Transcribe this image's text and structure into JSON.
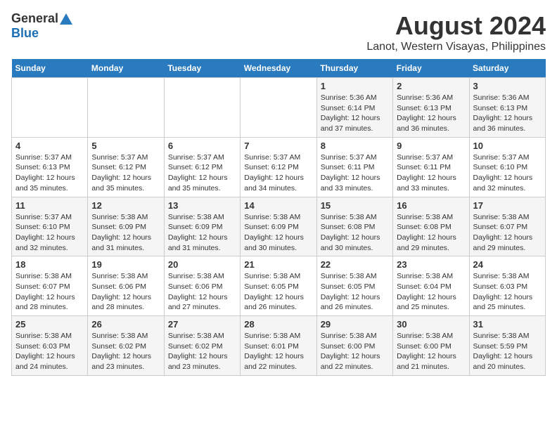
{
  "header": {
    "logo_general": "General",
    "logo_blue": "Blue",
    "month_title": "August 2024",
    "location": "Lanot, Western Visayas, Philippines"
  },
  "weekdays": [
    "Sunday",
    "Monday",
    "Tuesday",
    "Wednesday",
    "Thursday",
    "Friday",
    "Saturday"
  ],
  "weeks": [
    [
      {
        "day": "",
        "detail": ""
      },
      {
        "day": "",
        "detail": ""
      },
      {
        "day": "",
        "detail": ""
      },
      {
        "day": "",
        "detail": ""
      },
      {
        "day": "1",
        "detail": "Sunrise: 5:36 AM\nSunset: 6:14 PM\nDaylight: 12 hours\nand 37 minutes."
      },
      {
        "day": "2",
        "detail": "Sunrise: 5:36 AM\nSunset: 6:13 PM\nDaylight: 12 hours\nand 36 minutes."
      },
      {
        "day": "3",
        "detail": "Sunrise: 5:36 AM\nSunset: 6:13 PM\nDaylight: 12 hours\nand 36 minutes."
      }
    ],
    [
      {
        "day": "4",
        "detail": "Sunrise: 5:37 AM\nSunset: 6:13 PM\nDaylight: 12 hours\nand 35 minutes."
      },
      {
        "day": "5",
        "detail": "Sunrise: 5:37 AM\nSunset: 6:12 PM\nDaylight: 12 hours\nand 35 minutes."
      },
      {
        "day": "6",
        "detail": "Sunrise: 5:37 AM\nSunset: 6:12 PM\nDaylight: 12 hours\nand 35 minutes."
      },
      {
        "day": "7",
        "detail": "Sunrise: 5:37 AM\nSunset: 6:12 PM\nDaylight: 12 hours\nand 34 minutes."
      },
      {
        "day": "8",
        "detail": "Sunrise: 5:37 AM\nSunset: 6:11 PM\nDaylight: 12 hours\nand 33 minutes."
      },
      {
        "day": "9",
        "detail": "Sunrise: 5:37 AM\nSunset: 6:11 PM\nDaylight: 12 hours\nand 33 minutes."
      },
      {
        "day": "10",
        "detail": "Sunrise: 5:37 AM\nSunset: 6:10 PM\nDaylight: 12 hours\nand 32 minutes."
      }
    ],
    [
      {
        "day": "11",
        "detail": "Sunrise: 5:37 AM\nSunset: 6:10 PM\nDaylight: 12 hours\nand 32 minutes."
      },
      {
        "day": "12",
        "detail": "Sunrise: 5:38 AM\nSunset: 6:09 PM\nDaylight: 12 hours\nand 31 minutes."
      },
      {
        "day": "13",
        "detail": "Sunrise: 5:38 AM\nSunset: 6:09 PM\nDaylight: 12 hours\nand 31 minutes."
      },
      {
        "day": "14",
        "detail": "Sunrise: 5:38 AM\nSunset: 6:09 PM\nDaylight: 12 hours\nand 30 minutes."
      },
      {
        "day": "15",
        "detail": "Sunrise: 5:38 AM\nSunset: 6:08 PM\nDaylight: 12 hours\nand 30 minutes."
      },
      {
        "day": "16",
        "detail": "Sunrise: 5:38 AM\nSunset: 6:08 PM\nDaylight: 12 hours\nand 29 minutes."
      },
      {
        "day": "17",
        "detail": "Sunrise: 5:38 AM\nSunset: 6:07 PM\nDaylight: 12 hours\nand 29 minutes."
      }
    ],
    [
      {
        "day": "18",
        "detail": "Sunrise: 5:38 AM\nSunset: 6:07 PM\nDaylight: 12 hours\nand 28 minutes."
      },
      {
        "day": "19",
        "detail": "Sunrise: 5:38 AM\nSunset: 6:06 PM\nDaylight: 12 hours\nand 28 minutes."
      },
      {
        "day": "20",
        "detail": "Sunrise: 5:38 AM\nSunset: 6:06 PM\nDaylight: 12 hours\nand 27 minutes."
      },
      {
        "day": "21",
        "detail": "Sunrise: 5:38 AM\nSunset: 6:05 PM\nDaylight: 12 hours\nand 26 minutes."
      },
      {
        "day": "22",
        "detail": "Sunrise: 5:38 AM\nSunset: 6:05 PM\nDaylight: 12 hours\nand 26 minutes."
      },
      {
        "day": "23",
        "detail": "Sunrise: 5:38 AM\nSunset: 6:04 PM\nDaylight: 12 hours\nand 25 minutes."
      },
      {
        "day": "24",
        "detail": "Sunrise: 5:38 AM\nSunset: 6:03 PM\nDaylight: 12 hours\nand 25 minutes."
      }
    ],
    [
      {
        "day": "25",
        "detail": "Sunrise: 5:38 AM\nSunset: 6:03 PM\nDaylight: 12 hours\nand 24 minutes."
      },
      {
        "day": "26",
        "detail": "Sunrise: 5:38 AM\nSunset: 6:02 PM\nDaylight: 12 hours\nand 23 minutes."
      },
      {
        "day": "27",
        "detail": "Sunrise: 5:38 AM\nSunset: 6:02 PM\nDaylight: 12 hours\nand 23 minutes."
      },
      {
        "day": "28",
        "detail": "Sunrise: 5:38 AM\nSunset: 6:01 PM\nDaylight: 12 hours\nand 22 minutes."
      },
      {
        "day": "29",
        "detail": "Sunrise: 5:38 AM\nSunset: 6:00 PM\nDaylight: 12 hours\nand 22 minutes."
      },
      {
        "day": "30",
        "detail": "Sunrise: 5:38 AM\nSunset: 6:00 PM\nDaylight: 12 hours\nand 21 minutes."
      },
      {
        "day": "31",
        "detail": "Sunrise: 5:38 AM\nSunset: 5:59 PM\nDaylight: 12 hours\nand 20 minutes."
      }
    ]
  ]
}
